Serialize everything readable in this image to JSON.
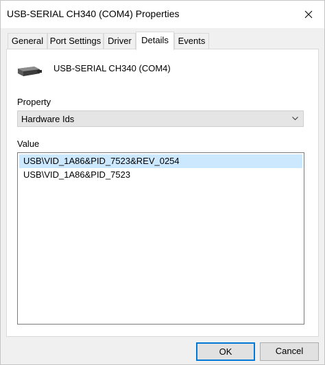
{
  "window": {
    "title": "USB-SERIAL CH340 (COM4) Properties"
  },
  "icons": {
    "close": "close-icon",
    "device": "serial-port-icon",
    "dropdown": "chevron-down-icon"
  },
  "tabs": [
    {
      "label": "General"
    },
    {
      "label": "Port Settings"
    },
    {
      "label": "Driver"
    },
    {
      "label": "Details",
      "active": true
    },
    {
      "label": "Events"
    }
  ],
  "details": {
    "device_name": "USB-SERIAL CH340 (COM4)",
    "property_label": "Property",
    "property_value": "Hardware Ids",
    "value_label": "Value",
    "values": [
      "USB\\VID_1A86&PID_7523&REV_0254",
      "USB\\VID_1A86&PID_7523"
    ]
  },
  "buttons": {
    "ok": "OK",
    "cancel": "Cancel"
  },
  "colors": {
    "selection": "#cce8ff",
    "default_button_border": "#0078d7"
  }
}
